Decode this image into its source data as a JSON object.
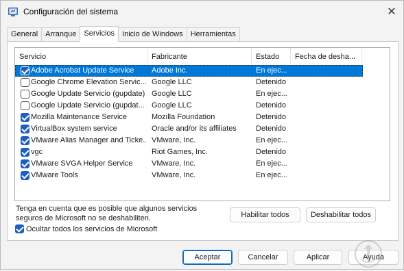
{
  "window": {
    "title": "Configuración del sistema",
    "close_glyph": "✕",
    "app_icon": "msconfig-icon"
  },
  "tabs": [
    {
      "label": "General",
      "active": false
    },
    {
      "label": "Arranque",
      "active": false
    },
    {
      "label": "Servicios",
      "active": true
    },
    {
      "label": "Inicio de Windows",
      "active": false
    },
    {
      "label": "Herramientas",
      "active": false
    }
  ],
  "columns": {
    "service": "Servicio",
    "manufacturer": "Fabricante",
    "state": "Estado",
    "disabled_date": "Fecha de desha..."
  },
  "services": [
    {
      "name": "Adobe Acrobat Update Service",
      "manufacturer": "Adobe Inc.",
      "state": "En ejec...",
      "checked": true,
      "selected": true
    },
    {
      "name": "Google Chrome Elevation Servic...",
      "manufacturer": "Google LLC",
      "state": "Detenido",
      "checked": false,
      "selected": false
    },
    {
      "name": "Google Update Servicio (gupdate)",
      "manufacturer": "Google LLC",
      "state": "En ejec...",
      "checked": false,
      "selected": false
    },
    {
      "name": "Google Update Servicio (gupdat...",
      "manufacturer": "Google LLC",
      "state": "Detenido",
      "checked": false,
      "selected": false
    },
    {
      "name": "Mozilla Maintenance Service",
      "manufacturer": "Mozilla Foundation",
      "state": "Detenido",
      "checked": true,
      "selected": false
    },
    {
      "name": "VirtualBox system service",
      "manufacturer": "Oracle and/or its affiliates",
      "state": "Detenido",
      "checked": true,
      "selected": false
    },
    {
      "name": "VMware Alias Manager and Ticke...",
      "manufacturer": "VMware, Inc.",
      "state": "En ejec...",
      "checked": true,
      "selected": false
    },
    {
      "name": "vgc",
      "manufacturer": "Riot Games, Inc.",
      "state": "Detenido",
      "checked": true,
      "selected": false
    },
    {
      "name": "VMware SVGA Helper Service",
      "manufacturer": "VMware, Inc.",
      "state": "En ejec...",
      "checked": true,
      "selected": false
    },
    {
      "name": "VMware Tools",
      "manufacturer": "VMware, Inc.",
      "state": "En ejec...",
      "checked": true,
      "selected": false
    }
  ],
  "note": {
    "line1": "Tenga en cuenta que es posible que algunos servicios",
    "line2": "seguros de Microsoft no se deshabiliten."
  },
  "buttons": {
    "enable_all": "Habilitar todos",
    "disable_all": "Deshabilitar todos",
    "ok": "Aceptar",
    "cancel": "Cancelar",
    "apply": "Aplicar",
    "help": "Ayuda"
  },
  "hide_microsoft": {
    "label": "Ocultar todos los servicios de Microsoft",
    "checked": true
  },
  "colors": {
    "selection": "#0078d7",
    "accent": "#0f6cbd",
    "checkbox": "#1f5fbf"
  }
}
